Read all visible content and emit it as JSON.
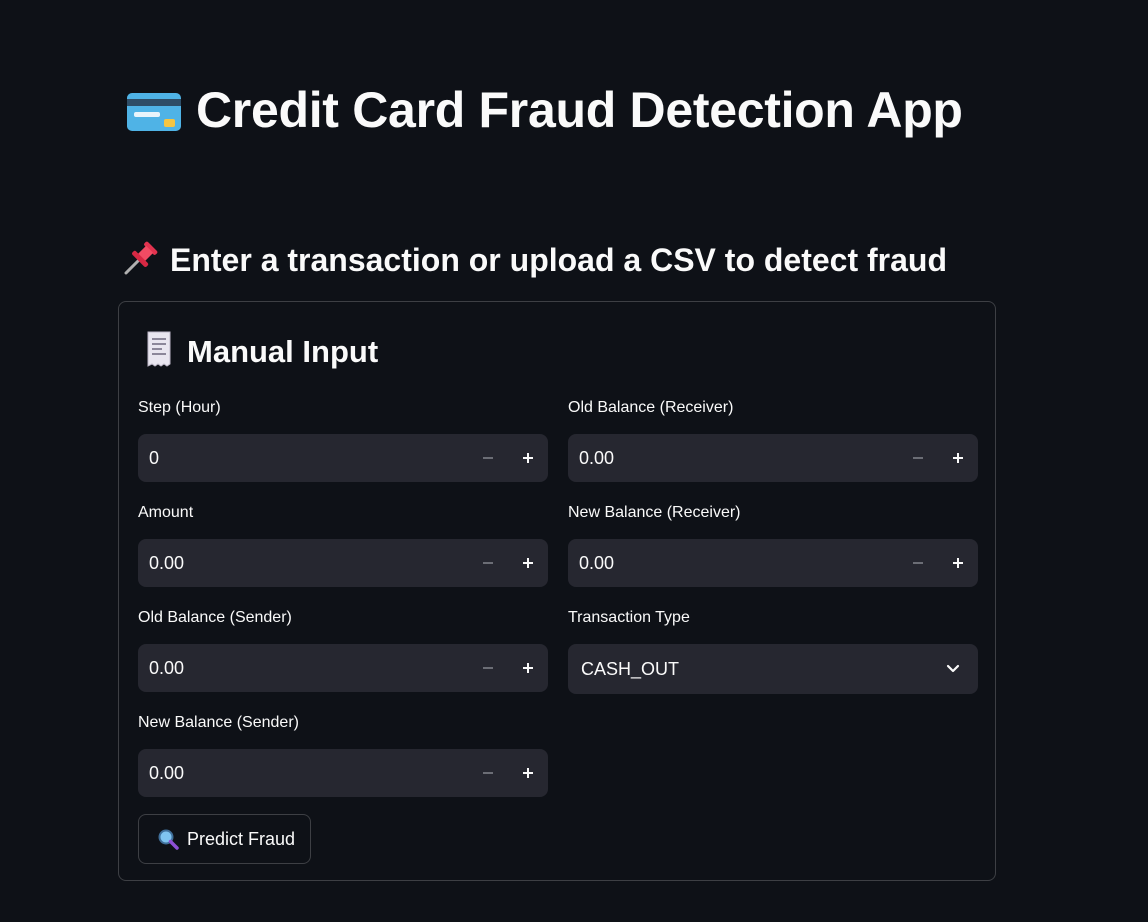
{
  "header": {
    "title": "Credit Card Fraud Detection App",
    "title_icon": "credit-card-icon",
    "subtitle": "Enter a transaction or upload a CSV to detect fraud",
    "subtitle_icon": "pushpin-icon"
  },
  "manual_input": {
    "heading": "Manual Input",
    "heading_icon": "receipt-icon",
    "fields": {
      "step": {
        "label": "Step (Hour)",
        "value": "0"
      },
      "amount": {
        "label": "Amount",
        "value": "0.00"
      },
      "old_balance_sender": {
        "label": "Old Balance (Sender)",
        "value": "0.00"
      },
      "new_balance_sender": {
        "label": "New Balance (Sender)",
        "value": "0.00"
      },
      "old_balance_receiver": {
        "label": "Old Balance (Receiver)",
        "value": "0.00"
      },
      "new_balance_receiver": {
        "label": "New Balance (Receiver)",
        "value": "0.00"
      },
      "transaction_type": {
        "label": "Transaction Type",
        "value": "CASH_OUT"
      }
    },
    "predict_button": {
      "label": "Predict Fraud",
      "icon": "magnifying-glass-icon"
    }
  },
  "colors": {
    "background": "#0e1117",
    "input_bg": "#262730",
    "text": "#fafafa",
    "border": "rgba(250,250,250,0.2)"
  }
}
